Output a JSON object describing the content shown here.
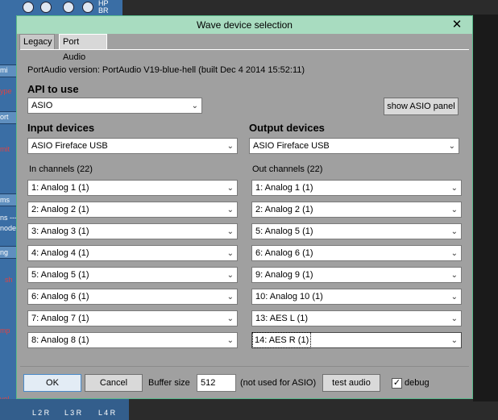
{
  "background_app": {
    "labels": [
      "mi",
      "ype",
      "ort",
      "mit",
      "ms",
      "ns ---",
      "node",
      "ng",
      "sh",
      "mp",
      "vel"
    ],
    "hp_label": "HP",
    "br_label": "BR",
    "bottom_labels": [
      "L 2 R",
      "L 3 R",
      "L 4 R"
    ]
  },
  "dialog": {
    "title": "Wave device selection",
    "close_symbol": "✕",
    "tabs": [
      {
        "label": "Legacy",
        "active": false
      },
      {
        "label": "Port Audio",
        "active": true
      }
    ],
    "version_text": "PortAudio version: PortAudio V19-blue-hell (built Dec  4 2014 15:52:11)",
    "api": {
      "heading": "API to use",
      "selected": "ASIO",
      "show_panel_button": "show ASIO panel"
    },
    "input": {
      "heading": "Input devices",
      "device": "ASIO Fireface USB",
      "channels_label": "In channels  (22)",
      "channels": [
        "1: Analog 1 (1)",
        "2: Analog 2 (1)",
        "3: Analog 3 (1)",
        "4: Analog 4 (1)",
        "5: Analog 5 (1)",
        "6: Analog 6 (1)",
        "7: Analog 7 (1)",
        "8: Analog 8 (1)"
      ]
    },
    "output": {
      "heading": "Output devices",
      "device": "ASIO Fireface USB",
      "channels_label": "Out channels  (22)",
      "channels": [
        "1: Analog 1 (1)",
        "2: Analog 2 (1)",
        "5: Analog 5 (1)",
        "6: Analog 6 (1)",
        "9: Analog 9 (1)",
        "10: Analog 10 (1)",
        "13: AES L (1)",
        "14: AES R (1)"
      ]
    },
    "footer": {
      "ok": "OK",
      "cancel": "Cancel",
      "buffer_label": "Buffer size",
      "buffer_value": "512",
      "buffer_note": "(not used for ASIO)",
      "test_audio": "test audio",
      "debug_label": "debug",
      "debug_checked": true,
      "check_mark": "✓"
    },
    "chevron": "⌄",
    "colors": {
      "dialog_bg": "#a0a0a0",
      "titlebar_bg": "#a8dcc0",
      "border": "#59b98b"
    }
  }
}
